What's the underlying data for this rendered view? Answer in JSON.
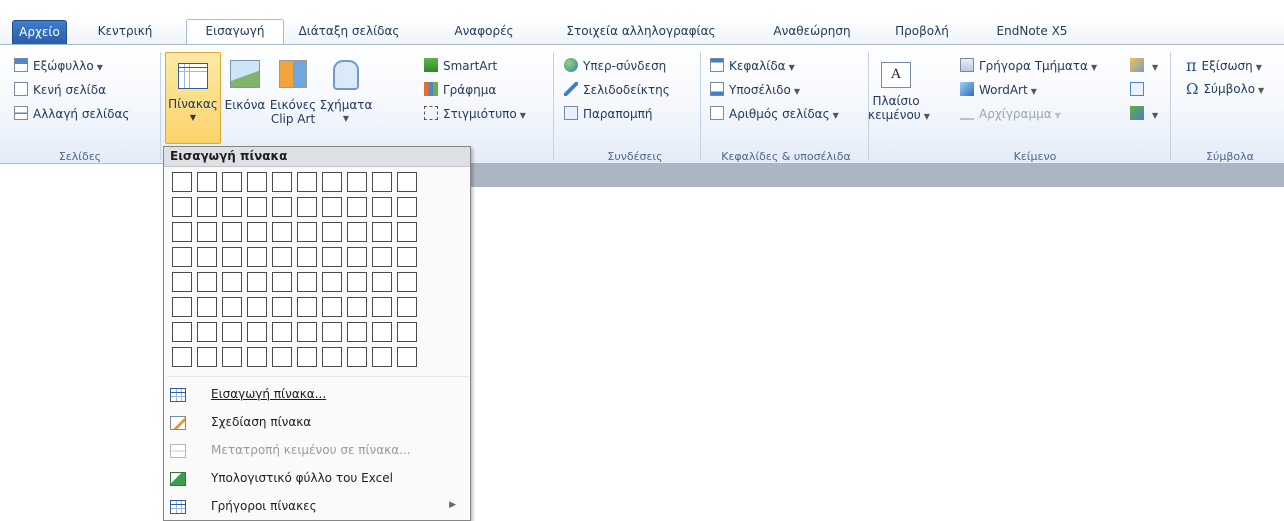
{
  "tabs": [
    "Αρχείο",
    "Κεντρική",
    "Εισαγωγή",
    "Διάταξη σελίδας",
    "Αναφορές",
    "Στοιχεία αλληλογραφίας",
    "Αναθεώρηση",
    "Προβολή",
    "EndNote X5"
  ],
  "active_tab": "Εισαγωγή",
  "groups": {
    "pages": {
      "label": "Σελίδες",
      "items": [
        "Εξώφυλλο",
        "Κενή σελίδα",
        "Αλλαγή σελίδας"
      ]
    },
    "tables": {
      "table_button": "Πίνακας"
    },
    "illustrations": {
      "picture": "Εικόνα",
      "clipart_line1": "Εικόνες",
      "clipart_line2": "Clip Art",
      "shapes": "Σχήματα",
      "smartart": "SmartArt",
      "chart": "Γράφημα",
      "screenshot": "Στιγμιότυπο"
    },
    "links": {
      "label": "Συνδέσεις",
      "items": [
        "Υπερ-σύνδεση",
        "Σελιδοδείκτης",
        "Παραπομπή"
      ]
    },
    "header_footer": {
      "label": "Κεφαλίδες & υποσέλιδα",
      "items": [
        "Κεφαλίδα",
        "Υποσέλιδο",
        "Αριθμός σελίδας"
      ]
    },
    "text": {
      "label": "Κείμενο",
      "textbox_line1": "Πλαίσιο",
      "textbox_line2": "κειμένου",
      "quick_parts": "Γρήγορα Τμήματα",
      "wordart": "WordArt",
      "dropcap": "Αρχίγραμμα"
    },
    "symbols": {
      "label": "Σύμβολα",
      "equation": "Εξίσωση",
      "symbol": "Σύμβολο"
    }
  },
  "menu": {
    "header": "Εισαγωγή πίνακα",
    "grid": {
      "columns": 10,
      "rows": 8
    },
    "items": [
      {
        "label": "Εισαγωγή πίνακα...",
        "icon": "insert-table-icon",
        "enabled": true
      },
      {
        "label": "Σχεδίαση πίνακα",
        "icon": "draw-table-icon",
        "enabled": true
      },
      {
        "label": "Μετατροπή κειμένου σε πίνακα...",
        "icon": "convert-text-icon",
        "enabled": false
      },
      {
        "label": "Υπολογιστικό φύλλο του Excel",
        "icon": "excel-sheet-icon",
        "enabled": true
      },
      {
        "label": "Γρήγοροι πίνακες",
        "icon": "quick-tables-icon",
        "enabled": true
      }
    ]
  },
  "colors": {
    "file_tab": "#2a5fa7",
    "ribbon_text": "#1e395b",
    "doc_gray": "#abb6c5"
  }
}
